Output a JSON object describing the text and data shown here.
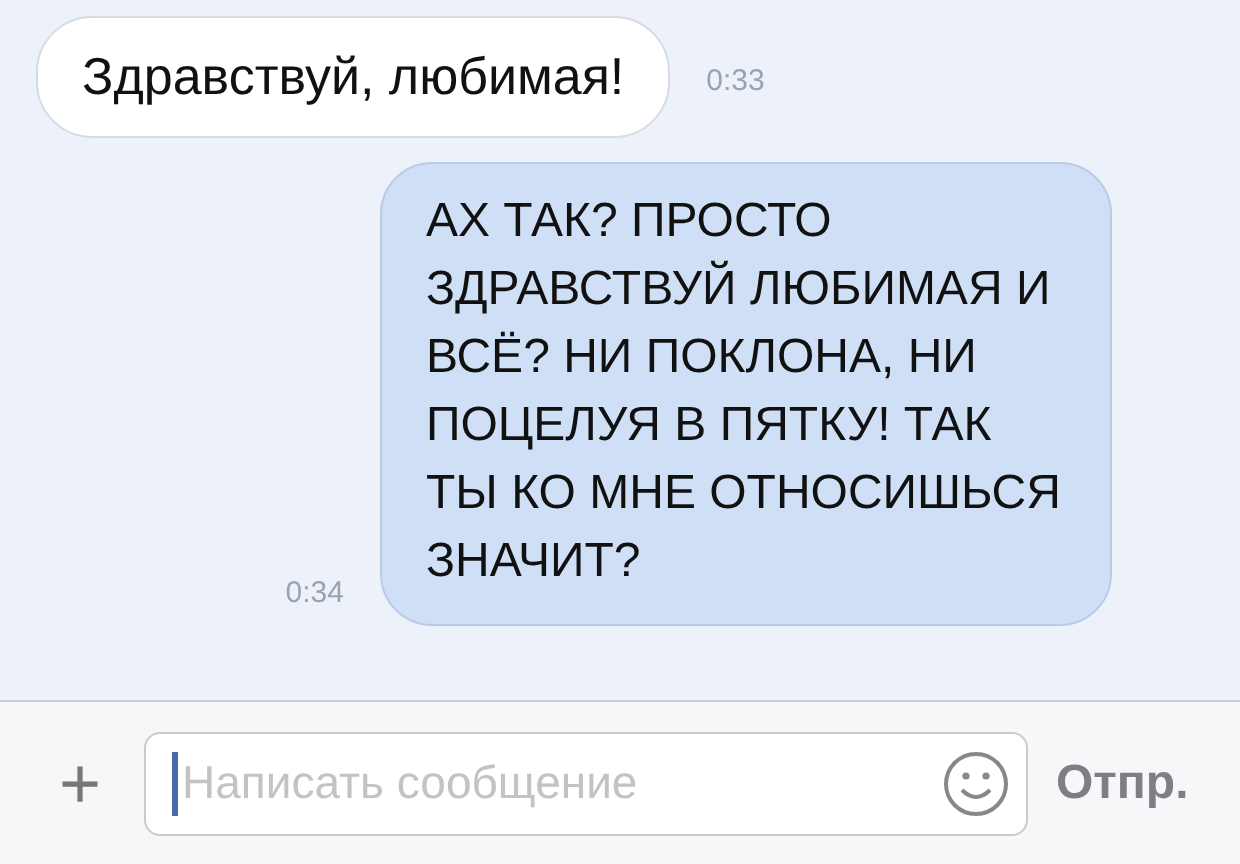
{
  "messages": [
    {
      "kind": "incoming",
      "text": "Здравствуй, любимая!",
      "time": "0:33"
    },
    {
      "kind": "outgoing",
      "text": "АХ ТАК? ПРОСТО ЗДРАВСТВУЙ ЛЮБИМАЯ И ВСЁ? НИ ПОКЛОНА, НИ ПОЦЕЛУЯ В ПЯТКУ! ТАК ТЫ КО МНЕ ОТНОСИШЬСЯ ЗНАЧИТ?",
      "time": "0:34"
    }
  ],
  "composer": {
    "attach": "+",
    "placeholder": "Написать сообщение",
    "send": "Отпр."
  }
}
